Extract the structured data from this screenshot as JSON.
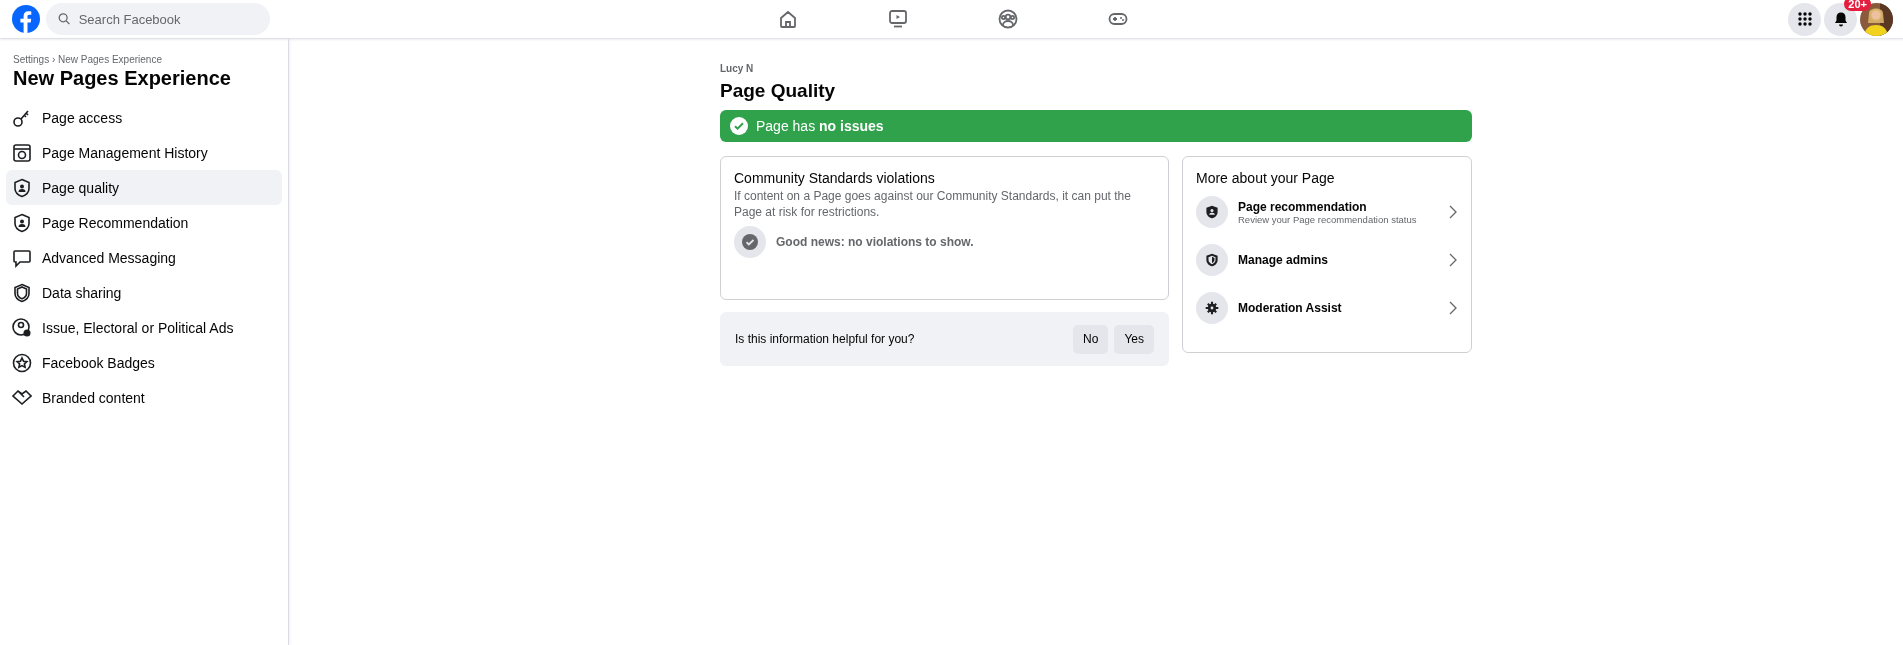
{
  "header": {
    "search": {
      "placeholder": "Search Facebook"
    },
    "notifications": {
      "badge": "20+"
    }
  },
  "sidebar": {
    "breadcrumb": "Settings › New Pages Experience",
    "title": "New Pages Experience",
    "items": [
      {
        "label": "Page access",
        "selected": false
      },
      {
        "label": "Page Management History",
        "selected": false
      },
      {
        "label": "Page quality",
        "selected": true
      },
      {
        "label": "Page Recommendation",
        "selected": false
      },
      {
        "label": "Advanced Messaging",
        "selected": false
      },
      {
        "label": "Data sharing",
        "selected": false
      },
      {
        "label": "Issue, Electoral or Political Ads",
        "selected": false
      },
      {
        "label": "Facebook Badges",
        "selected": false
      },
      {
        "label": "Branded content",
        "selected": false
      }
    ]
  },
  "main": {
    "page_name": "Lucy N",
    "title": "Page Quality",
    "status_banner": "Page has **no issues**",
    "violations_card": {
      "title": "Community Standards violations",
      "description": "If content on a Page goes against our Community Standards, it can put the Page at risk for restrictions.",
      "result": "Good news: no violations to show."
    },
    "feedback": {
      "question": "Is this information helpful for you?",
      "buttons": [
        "No",
        "Yes"
      ]
    },
    "more_card": {
      "title": "More about your Page",
      "items": [
        {
          "title": "Page recommendation",
          "subtitle": "Review your Page recommendation status"
        },
        {
          "title": "Manage admins"
        },
        {
          "title": "Moderation Assist"
        }
      ]
    }
  }
}
